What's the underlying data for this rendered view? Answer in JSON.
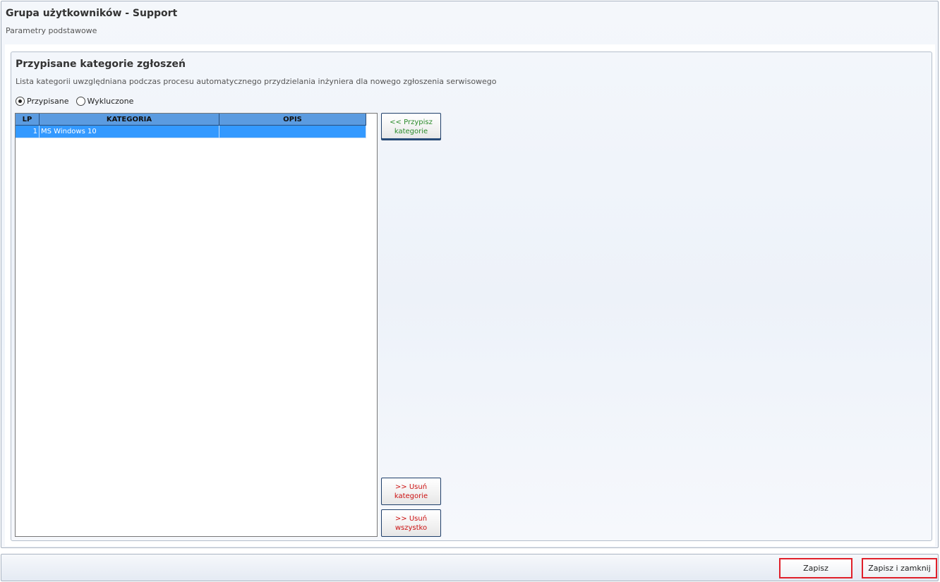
{
  "header": {
    "title": "Grupa użytkowników - Support",
    "subtitle": "Parametry podstawowe"
  },
  "section": {
    "title": "Przypisane kategorie zgłoszeń",
    "description": "Lista kategorii uwzględniana podczas procesu automatycznego przydzielania inżyniera dla nowego zgłoszenia serwisowego"
  },
  "filter": {
    "options": [
      {
        "label": "Przypisane",
        "checked": true
      },
      {
        "label": "Wykluczone",
        "checked": false
      }
    ]
  },
  "grid": {
    "columns": [
      "LP",
      "KATEGORIA",
      "OPIS"
    ],
    "rows": [
      {
        "lp": "1",
        "kategoria": "MS Windows 10",
        "opis": "",
        "selected": true
      }
    ]
  },
  "buttons": {
    "assign": "<< Przypisz\nkategorie",
    "remove": ">> Usuń\nkategorie",
    "remove_all": ">> Usuń\nwszystko"
  },
  "footer": {
    "save": "Zapisz",
    "save_close": "Zapisz i zamknij"
  },
  "colors": {
    "grid_header": "#5b9be0",
    "selected_row": "#3399ff",
    "assign_text": "#2a8a2a",
    "remove_text": "#cc1111",
    "highlight_border": "#e0202a"
  }
}
